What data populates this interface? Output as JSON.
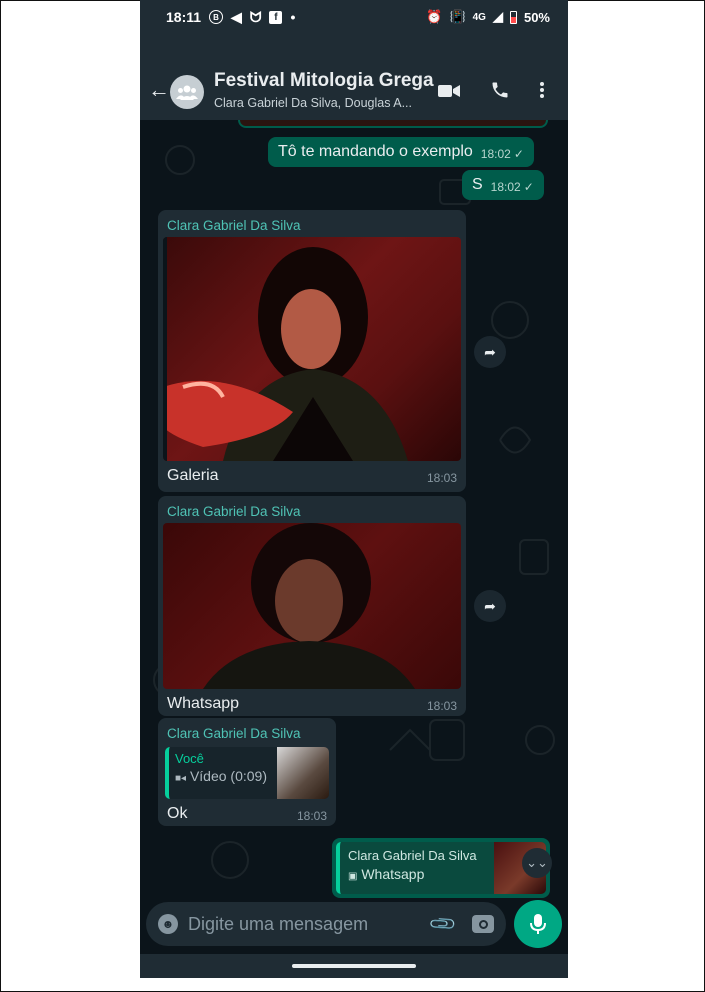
{
  "status_bar": {
    "time": "18:11",
    "network": "4G",
    "battery": "50%"
  },
  "header": {
    "title": "Festival Mitologia Grega",
    "subtitle": "Clara Gabriel Da Silva, Douglas A..."
  },
  "messages": [
    {
      "type": "outgoing",
      "text": "Tô te mandando o exemplo",
      "time": "18:02"
    },
    {
      "type": "outgoing",
      "text": "S",
      "time": "18:02"
    },
    {
      "type": "incoming_photo",
      "sender": "Clara Gabriel Da Silva",
      "caption": "Galeria",
      "time": "18:03"
    },
    {
      "type": "incoming_photo",
      "sender": "Clara Gabriel Da Silva",
      "caption": "Whatsapp",
      "time": "18:03"
    },
    {
      "type": "incoming_reply",
      "sender": "Clara Gabriel Da Silva",
      "quoted_author": "Você",
      "quoted_text": "Vídeo (0:09)",
      "text": "Ok",
      "time": "18:03"
    },
    {
      "type": "outgoing_reply_partial",
      "quoted_author": "Clara Gabriel Da Silva",
      "quoted_text": "Whatsapp"
    }
  ],
  "composer": {
    "placeholder": "Digite uma mensagem"
  },
  "colors": {
    "header_bg": "#1f2c34",
    "chat_bg": "#0b141a",
    "outgoing_bubble": "#005c4b",
    "incoming_bubble": "#1f2c34",
    "accent": "#00a884",
    "sender_name": "#4fc3b5"
  }
}
